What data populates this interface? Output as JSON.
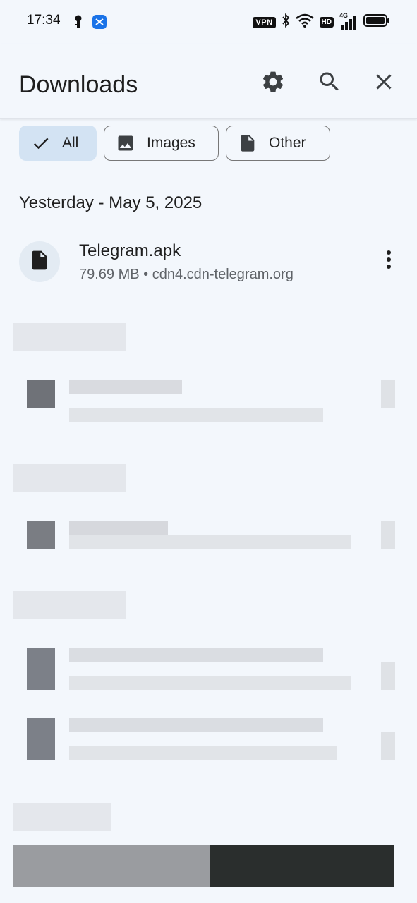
{
  "status_bar": {
    "time": "17:34",
    "vpn_label": "VPN",
    "hd_label": "HD",
    "network_label": "4G",
    "icons": [
      "key-icon",
      "app-notification-icon",
      "bluetooth-icon",
      "wifi-icon",
      "signal-icon",
      "battery-icon"
    ]
  },
  "app_bar": {
    "title": "Downloads",
    "actions": [
      "settings-icon",
      "search-icon",
      "close-icon"
    ]
  },
  "filters": {
    "all": "All",
    "images": "Images",
    "other": "Other",
    "selected": "All",
    "selected_color": "#d3e3f3"
  },
  "downloads": {
    "section_date": "Yesterday - May 5, 2025",
    "item": {
      "name": "Telegram.apk",
      "meta": "79.69 MB • cdn4.cdn-telegram.org",
      "icon": "file-icon"
    }
  },
  "colors": {
    "background": "#f3f7fc",
    "chip_border": "#777777",
    "secondary_text": "#5f6368"
  }
}
